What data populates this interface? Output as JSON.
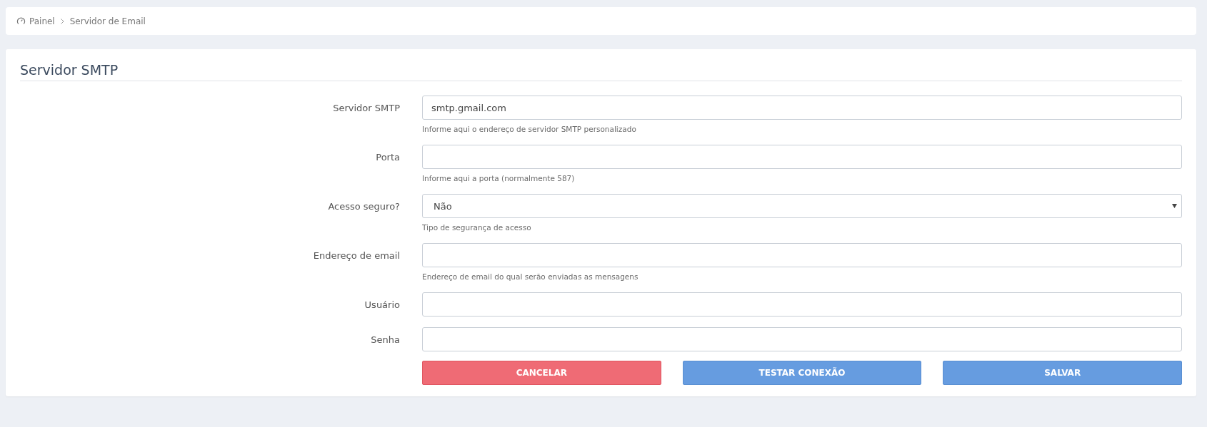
{
  "breadcrumb": [
    {
      "label": "Painel",
      "kind": "home"
    },
    {
      "label": "Servidor de Email",
      "kind": "page"
    }
  ],
  "title": "Servidor SMTP",
  "fields": [
    {
      "label": "Servidor SMTP",
      "kind": "text",
      "value": "smtp.gmail.com",
      "help": "Informe aqui o endereço de servidor SMTP personalizado"
    },
    {
      "label": "Porta",
      "kind": "text",
      "help": "Informe aqui a porta (normalmente 587)"
    },
    {
      "label": "Acesso seguro?",
      "kind": "select",
      "value": "Não",
      "help": "Tipo de segurança de acesso"
    },
    {
      "label": "Endereço de email",
      "kind": "text",
      "help": "Endereço de email do qual serão enviadas as mensagens"
    },
    {
      "label": "Usuário",
      "kind": "text"
    },
    {
      "label": "Senha",
      "kind": "password"
    }
  ],
  "buttons": [
    {
      "label": "CANCELAR",
      "kind": "danger"
    },
    {
      "label": "TESTAR CONEXÃO",
      "kind": "primary"
    },
    {
      "label": "SALVAR",
      "kind": "primary"
    }
  ]
}
